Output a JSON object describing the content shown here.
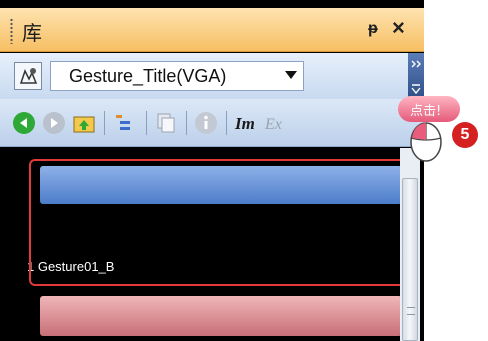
{
  "titlebar": {
    "title": "库",
    "pin_glyph": "ᵽ",
    "close_glyph": "×"
  },
  "library_select": {
    "value": "Gesture_Title(VGA)"
  },
  "toolbar": {
    "icons": [
      "back-icon",
      "forward-icon",
      "folder-up-icon",
      "list-view-icon",
      "copy-icon",
      "info-icon",
      "im-icon",
      "ex-icon"
    ]
  },
  "content": {
    "items": [
      {
        "label": "1 Gesture01_B",
        "color": "#6f95dc"
      },
      {
        "label": "",
        "color": "#d98d94"
      }
    ]
  },
  "callout": {
    "text": "点击!",
    "step": "5"
  },
  "colors": {
    "title_bg": "#f7c56a",
    "highlight": "#e23a3a",
    "badge": "#d42020"
  }
}
